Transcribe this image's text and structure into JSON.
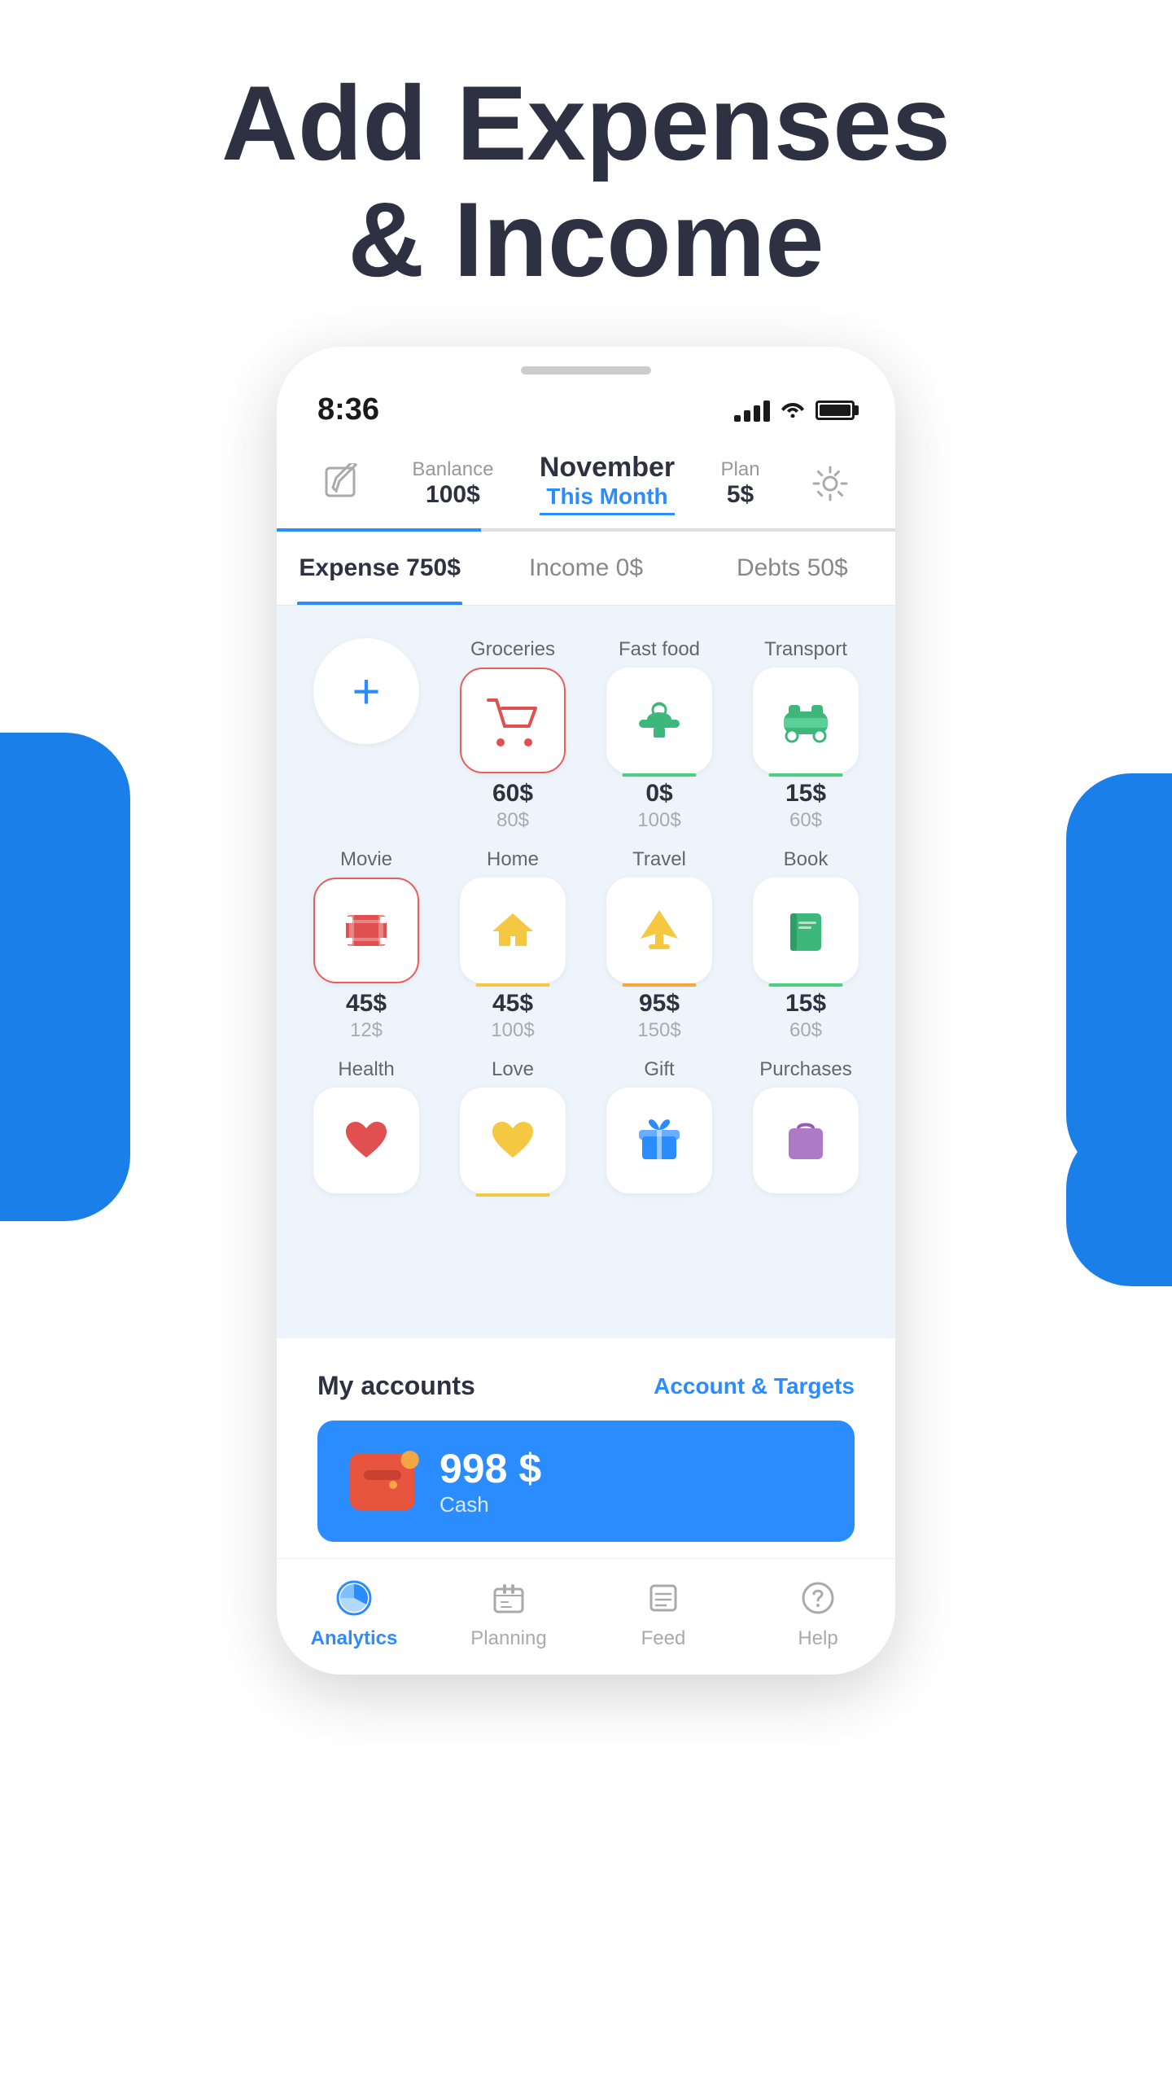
{
  "page": {
    "title_line1": "Add Expenses",
    "title_line2": "& Income"
  },
  "status_bar": {
    "time": "8:36"
  },
  "top_nav": {
    "balance_label": "Banlance",
    "balance_value": "100$",
    "month": "November",
    "this_month": "This Month",
    "plan_label": "Plan",
    "plan_value": "5$"
  },
  "tabs": [
    {
      "label": "Expense 750$",
      "active": true
    },
    {
      "label": "Income 0$",
      "active": false
    },
    {
      "label": "Debts 50$",
      "active": false
    }
  ],
  "categories_row1": [
    {
      "label": "",
      "is_add": true
    },
    {
      "label": "Groceries",
      "icon": "cart",
      "amount": "60$",
      "budget": "80$",
      "selected": true,
      "progress": null
    },
    {
      "label": "Fast food",
      "icon": "fastfood",
      "amount": "0$",
      "budget": "100$",
      "selected": false,
      "progress": "green"
    },
    {
      "label": "Transport",
      "icon": "car",
      "amount": "15$",
      "budget": "60$",
      "selected": false,
      "progress": "green"
    }
  ],
  "categories_row2": [
    {
      "label": "Movie",
      "icon": "movie",
      "amount": "45$",
      "budget": "12$",
      "selected": true,
      "progress": null
    },
    {
      "label": "Home",
      "icon": "home",
      "amount": "45$",
      "budget": "100$",
      "selected": false,
      "progress": "yellow"
    },
    {
      "label": "Travel",
      "icon": "travel",
      "amount": "95$",
      "budget": "150$",
      "selected": false,
      "progress": "orange"
    },
    {
      "label": "Book",
      "icon": "book",
      "amount": "15$",
      "budget": "60$",
      "selected": false,
      "progress": "green"
    }
  ],
  "categories_row3": [
    {
      "label": "Health",
      "icon": "health",
      "amount": "",
      "budget": "",
      "selected": false,
      "progress": null
    },
    {
      "label": "Love",
      "icon": "love",
      "amount": "",
      "budget": "",
      "selected": false,
      "progress": "yellow"
    },
    {
      "label": "Gift",
      "icon": "gift",
      "amount": "",
      "budget": "",
      "selected": false,
      "progress": null
    },
    {
      "label": "Purchases",
      "icon": "purchases",
      "amount": "",
      "budget": "",
      "selected": false,
      "progress": null
    }
  ],
  "accounts": {
    "section_title": "My accounts",
    "link_label": "Account & Targets",
    "card": {
      "amount": "998 $",
      "type": "Cash"
    }
  },
  "bottom_nav": [
    {
      "label": "Analytics",
      "icon": "chart",
      "active": true
    },
    {
      "label": "Planning",
      "icon": "briefcase",
      "active": false
    },
    {
      "label": "Feed",
      "icon": "feed",
      "active": false
    },
    {
      "label": "Help",
      "icon": "help",
      "active": false
    }
  ]
}
